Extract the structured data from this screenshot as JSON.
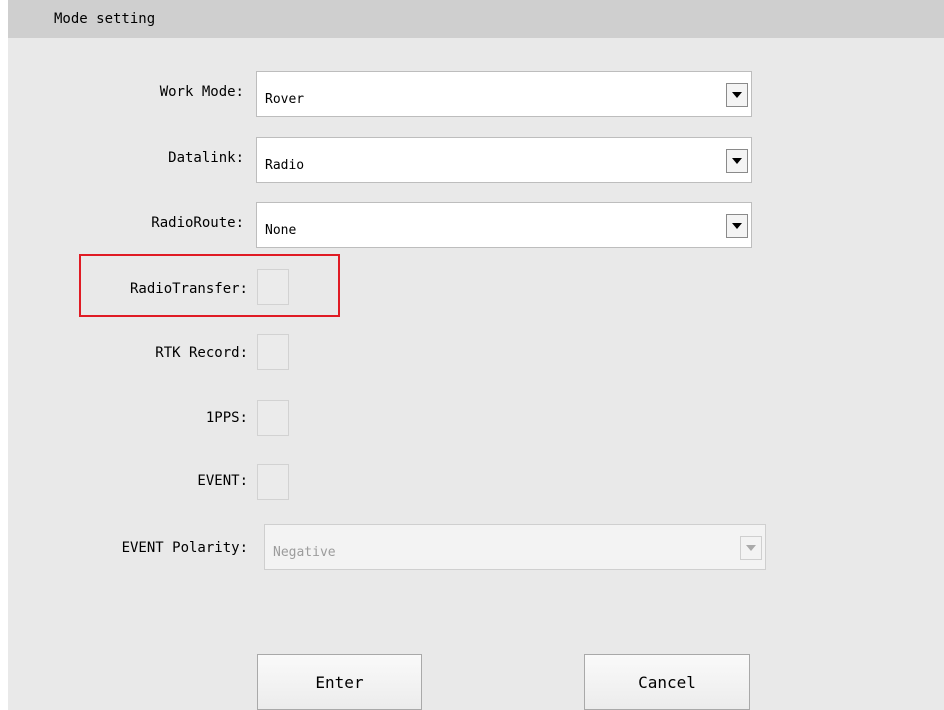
{
  "dialog": {
    "title": "Mode setting"
  },
  "fields": {
    "work_mode": {
      "label": "Work Mode:",
      "value": "Rover"
    },
    "datalink": {
      "label": "Datalink:",
      "value": "Radio"
    },
    "radio_route": {
      "label": "RadioRoute:",
      "value": "None"
    },
    "radio_transfer": {
      "label": "RadioTransfer:",
      "checked": false
    },
    "rtk_record": {
      "label": "RTK Record:",
      "checked": false
    },
    "pps": {
      "label": "1PPS:",
      "checked": false
    },
    "event": {
      "label": "EVENT:",
      "checked": false
    },
    "event_polarity": {
      "label": "EVENT Polarity:",
      "value": "Negative",
      "disabled": true
    }
  },
  "buttons": {
    "enter": "Enter",
    "cancel": "Cancel"
  },
  "colors": {
    "highlight": "#e01b24",
    "title_bar": "#cfcfcf",
    "panel": "#e9e9e9"
  }
}
